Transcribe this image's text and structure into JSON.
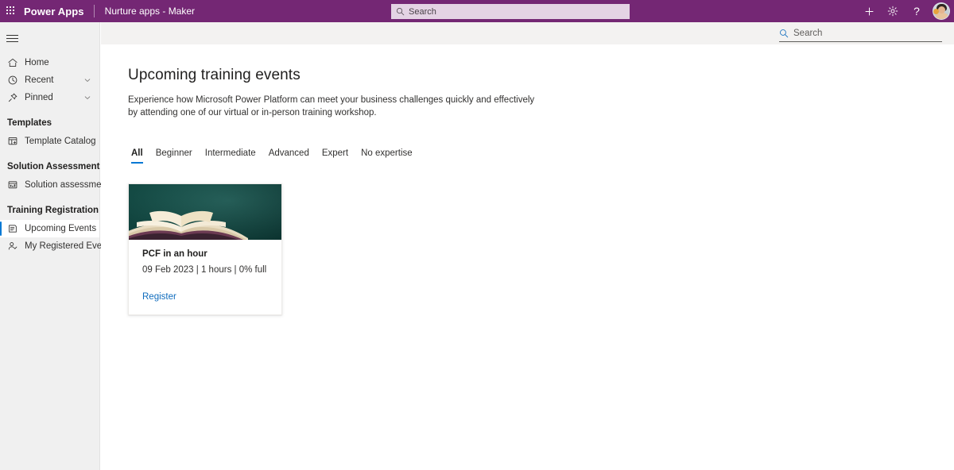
{
  "header": {
    "waffle_label": "App launcher",
    "brand": "Power Apps",
    "environment": "Nurture apps - Maker",
    "search_placeholder": "Search",
    "actions": [
      {
        "name": "new",
        "glyph": "+"
      },
      {
        "name": "settings",
        "glyph": "gear"
      },
      {
        "name": "help",
        "glyph": "?"
      }
    ],
    "accent_color": "#742774",
    "search_bg": "#e4d3e4"
  },
  "sidebar": {
    "toggle_label": "Collapse navigation",
    "items": [
      {
        "label": "Home",
        "icon": "home-icon",
        "expandable": false,
        "selected": false
      },
      {
        "label": "Recent",
        "icon": "clock-icon",
        "expandable": true,
        "selected": false
      },
      {
        "label": "Pinned",
        "icon": "pin-icon",
        "expandable": true,
        "selected": false
      }
    ],
    "groups": [
      {
        "title": "Templates",
        "items": [
          {
            "label": "Template Catalog",
            "icon": "template-catalog-icon",
            "selected": false
          }
        ]
      },
      {
        "title": "Solution Assessment",
        "items": [
          {
            "label": "Solution assessment",
            "icon": "solution-assessment-icon",
            "selected": false
          }
        ]
      },
      {
        "title": "Training Registration",
        "items": [
          {
            "label": "Upcoming Events",
            "icon": "upcoming-events-icon",
            "selected": true
          },
          {
            "label": "My Registered Events",
            "icon": "registered-events-icon",
            "selected": false
          }
        ]
      }
    ],
    "selected_accent": "#0078d4"
  },
  "command_bar": {
    "search_placeholder": "Search"
  },
  "main": {
    "title": "Upcoming training events",
    "description": "Experience how Microsoft Power Platform can meet your business challenges quickly and effectively by attending one of our virtual or in-person training workshop.",
    "tabs": [
      {
        "label": "All",
        "active": true
      },
      {
        "label": "Beginner",
        "active": false
      },
      {
        "label": "Intermediate",
        "active": false
      },
      {
        "label": "Advanced",
        "active": false
      },
      {
        "label": "Expert",
        "active": false
      },
      {
        "label": "No expertise",
        "active": false
      }
    ],
    "tab_accent": "#0078d4",
    "cards": [
      {
        "title": "PCF in an hour",
        "meta": "09 Feb 2023 | 1 hours | 0% full",
        "action_label": "Register",
        "image_alt": "open-book-photo",
        "image_bg": "#14534c",
        "link_color": "#0f6cbd"
      }
    ]
  }
}
